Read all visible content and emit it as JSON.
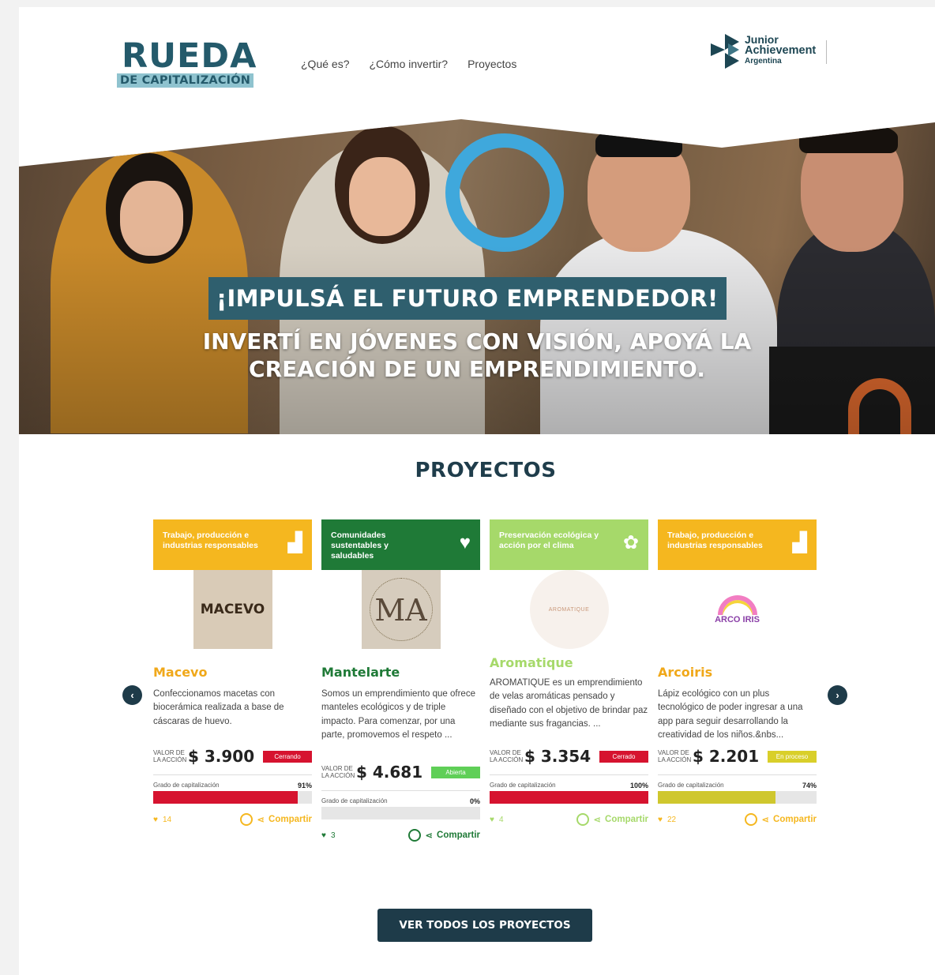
{
  "header": {
    "logo_line1": "RUEDA",
    "logo_line2": "DE CAPITALIZACIÓN",
    "nav": [
      "¿Qué es?",
      "¿Cómo invertir?",
      "Proyectos"
    ],
    "partner": {
      "line1": "Junior",
      "line2": "Achievement",
      "line3": "Argentina"
    }
  },
  "hero": {
    "tagline": "¡IMPULSÁ EL FUTURO EMPRENDEDOR!",
    "subtitle": "INVERTÍ EN JÓVENES CON VISIÓN, APOYÁ LA CREACIÓN DE UN EMPRENDIMIENTO."
  },
  "section": {
    "title": "PROYECTOS"
  },
  "labels": {
    "value_label": "VALOR DE LA ACCIÓN",
    "capitalization": "Grado de capitalización",
    "share": "Compartir"
  },
  "projects": [
    {
      "category": "Trabajo, producción e industrias responsables",
      "category_color": "#f5b71f",
      "category_icon": "bar-chart-icon",
      "logo_text": "MACEVO",
      "name": "Macevo",
      "name_color": "#f0a81a",
      "description": "Confeccionamos macetas con biocerámica realizada a base de cáscaras de huevo.",
      "price": "$ 3.900",
      "status": "Cerrando",
      "status_color": "#d6132f",
      "percent_text": "91%",
      "percent": 91,
      "bar_color": "#d6132f",
      "likes": "14",
      "accent": "#f5b71f"
    },
    {
      "category": "Comunidades sustentables y saludables",
      "category_color": "#1f7a37",
      "category_icon": "hand-heart-icon",
      "logo_text": "MA",
      "name": "Mantelarte",
      "name_color": "#1f7a37",
      "description": "Somos un emprendimiento que ofrece manteles ecológicos y de triple impacto. Para comenzar, por una parte, promovemos el respeto ...",
      "price": "$ 4.681",
      "status": "Abierta",
      "status_color": "#5fcf57",
      "percent_text": "0%",
      "percent": 0,
      "bar_color": "#5fcf57",
      "likes": "3",
      "accent": "#1f7a37"
    },
    {
      "category": "Preservación ecológica y acción por el clima",
      "category_color": "#a6d96a",
      "category_icon": "plant-hand-icon",
      "logo_text": "AROMATIQUE",
      "name": "Aromatique",
      "name_color": "#a6d96a",
      "description": "AROMATIQUE es un emprendimiento de velas aromáticas pensado y diseñado con el objetivo de brindar paz mediante sus fragancias. ...",
      "price": "$ 3.354",
      "status": "Cerrado",
      "status_color": "#d6132f",
      "percent_text": "100%",
      "percent": 100,
      "bar_color": "#d6132f",
      "likes": "4",
      "accent": "#a6d96a"
    },
    {
      "category": "Trabajo, producción e industrias responsables",
      "category_color": "#f5b71f",
      "category_icon": "bar-chart-icon",
      "logo_text": "ARCO IRIS",
      "name": "Arcoiris",
      "name_color": "#f0a81a",
      "description": "Lápiz ecológico con un plus tecnológico de poder ingresar a una app para seguir desarrollando la creatividad de los niños.&nbs...",
      "price": "$ 2.201",
      "status": "En proceso",
      "status_color": "#d9cf2a",
      "percent_text": "74%",
      "percent": 74,
      "bar_color": "#cfc72e",
      "likes": "22",
      "accent": "#f5b71f"
    }
  ],
  "cta": "VER TODOS LOS PROYECTOS"
}
